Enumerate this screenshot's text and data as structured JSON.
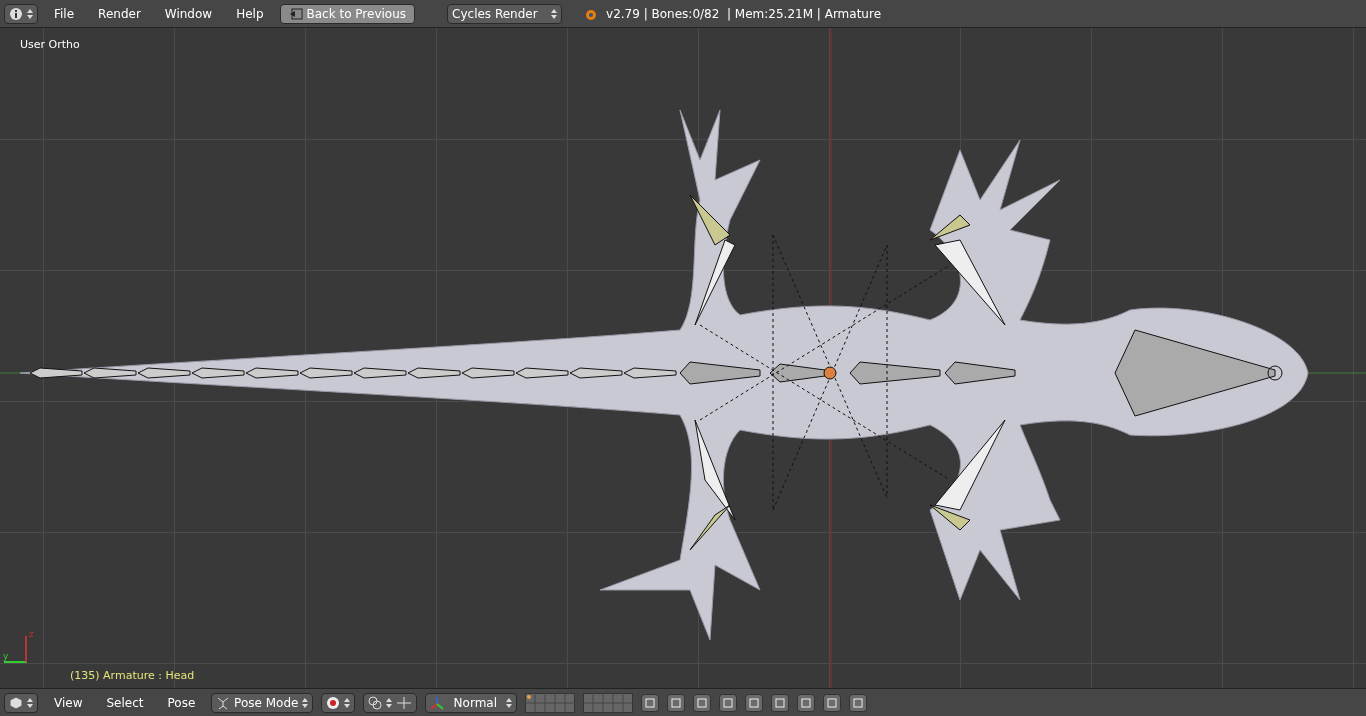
{
  "top_bar": {
    "menus": [
      "File",
      "Render",
      "Window",
      "Help"
    ],
    "back_button": "Back to Previous",
    "engine": "Cycles Render",
    "stats": "v2.79 | Bones:0/82  | Mem:25.21M | Armature"
  },
  "viewport": {
    "view_label": "User Ortho",
    "axis_labels": [
      "y",
      "z"
    ],
    "status": "(135) Armature : Head"
  },
  "bottom_bar": {
    "menus": [
      "View",
      "Select",
      "Pose"
    ],
    "mode": "Pose Mode",
    "orientation": "Normal"
  }
}
